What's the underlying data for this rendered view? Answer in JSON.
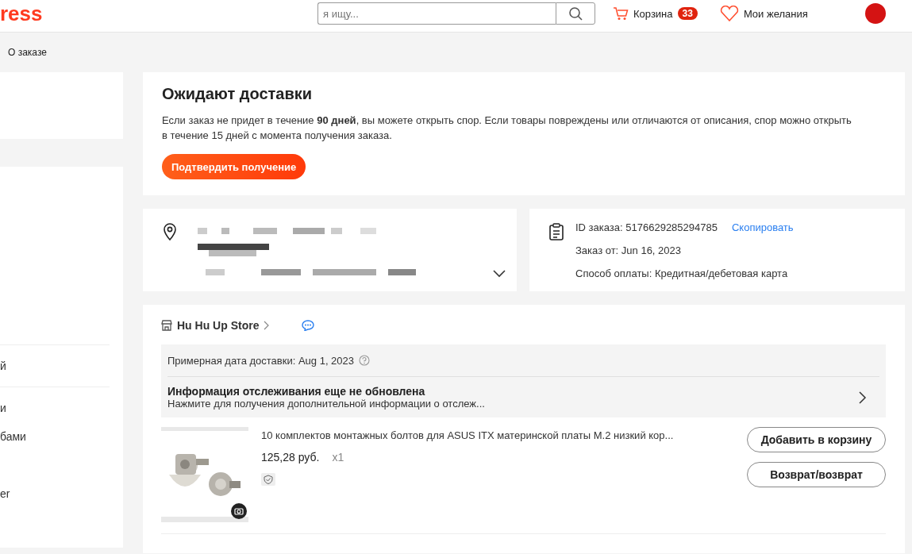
{
  "header": {
    "logo": "ress",
    "search": {
      "placeholder": "я ищу..."
    },
    "cart": {
      "label": "Корзина",
      "count": "33"
    },
    "wishlist": {
      "label": "Мои желания"
    }
  },
  "breadcrumb": [
    {
      "label": "О заказе"
    }
  ],
  "sidebar": {
    "sections": [
      {
        "items": [
          {
            "label": "й"
          }
        ]
      },
      {
        "items": [
          {
            "label": "и"
          },
          {
            "label": "бами"
          },
          {
            "label": "er"
          }
        ]
      }
    ]
  },
  "status": {
    "title": "Ожидают доставки",
    "message": "Если заказ не придет в течение **90 дней**, вы можете открыть спор. Если товары повреждены или отличаются от описания, спор можно открыть в течение 15 дней с момента получения заказа.",
    "button": "Подтвердить получение"
  },
  "order_info": {
    "id": "ID заказа: 5176629285294785",
    "copy_link": "Скопировать",
    "date": "Заказ от: Jun 16, 2023",
    "payment": "Способ оплаты: Кредитная/дебетовая карта"
  },
  "store": {
    "name": "Hu Hu Up Store",
    "delivery_date": "Примерная дата доставки: Aug 1, 2023",
    "tracking_title": "Информация отслеживания еще не обновлена",
    "tracking_hint": "Нажмите для получения дополнительной информации о отслеж...",
    "items": [
      {
        "title": "10 комплектов монтажных болтов для ASUS ITX материнской платы M.2 низкий кор...",
        "price": "125,28 руб.",
        "quantity": "x1",
        "buttons": [
          "Добавить в корзину",
          "Возврат/возврат"
        ]
      }
    ]
  }
}
